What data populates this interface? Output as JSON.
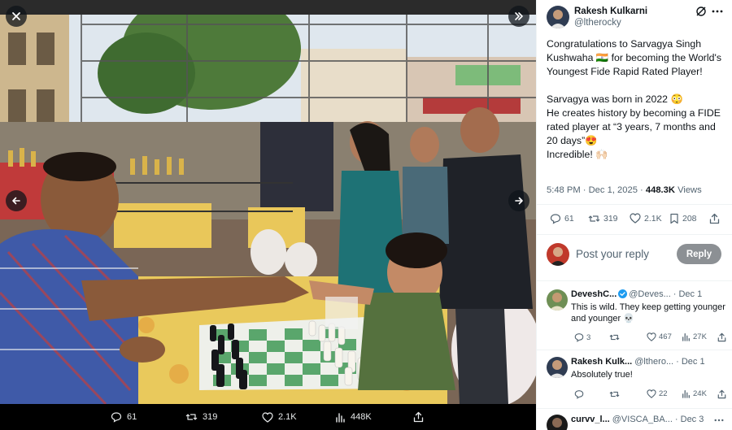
{
  "media": {
    "close_icon": "close-icon",
    "expand_icon": "chevron-double-right-icon",
    "prev_icon": "arrow-left-icon",
    "next_icon": "arrow-right-icon",
    "photo_alt": "",
    "bar": {
      "replies": "61",
      "reposts": "319",
      "likes": "2.1K",
      "views": "448K"
    }
  },
  "post": {
    "author_name": "Rakesh Kulkarni",
    "author_handle": "@ltherocky",
    "text_line1": "Congratulations to Sarvagya Singh Kushwaha 🇮🇳 for becoming the World's Youngest Fide Rapid Rated Player!",
    "text_line2": "Sarvagya was born in 2022 😳",
    "text_line3": "He creates history by becoming a FIDE rated player at “3 years, 7 months and 20 days”😍",
    "text_line4": "Incredible! 🙌🏻",
    "time": "5:48 PM · Dec 1, 2025 · ",
    "views_count": "448.3K",
    "views_label": " Views",
    "stats": {
      "replies": "61",
      "reposts": "319",
      "likes": "2.1K",
      "bookmarks": "208"
    }
  },
  "reply_box": {
    "placeholder": "Post your reply",
    "button": "Reply"
  },
  "replies": [
    {
      "name": "DeveshC...",
      "handle": "@Deves...",
      "date": "· Dec 1",
      "text": "This is wild. They keep getting younger and younger 💀",
      "replies": "3",
      "reposts": "",
      "likes": "467",
      "views": "27K"
    },
    {
      "name": "Rakesh Kulk...",
      "handle": "@lthero...",
      "date": "· Dec 1",
      "text": "Absolutely true!",
      "replies": "",
      "reposts": "",
      "likes": "22",
      "views": "24K"
    },
    {
      "name": "curvv_l...",
      "handle": "@VISCA_BA...",
      "date": "· Dec 3"
    }
  ],
  "colors": {
    "accent": "#1d9bf0",
    "reply_button": "#8c9094",
    "verified": "#1d9bf0"
  }
}
